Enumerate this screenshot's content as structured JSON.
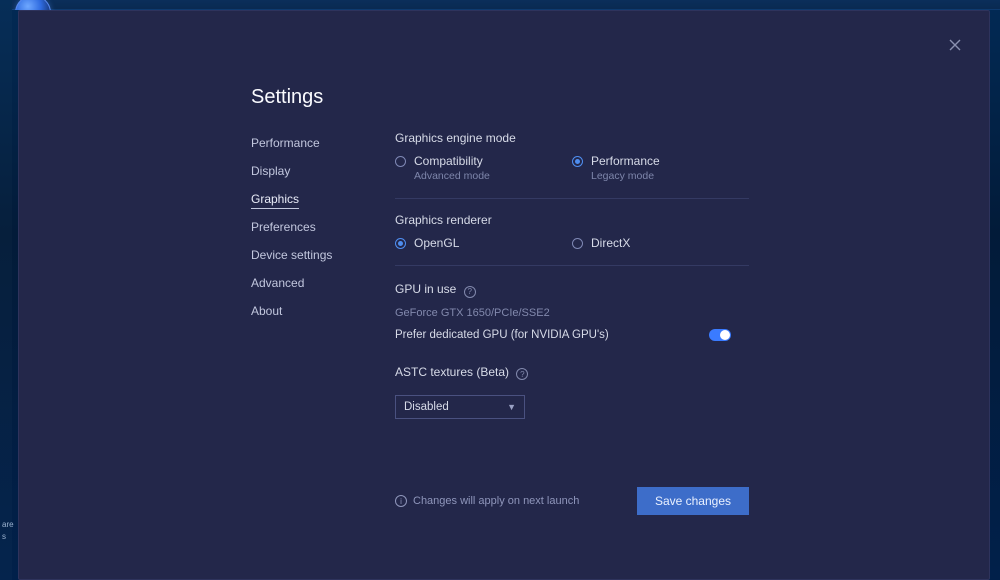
{
  "title": "Settings",
  "nav": {
    "items": [
      {
        "label": "Performance",
        "active": false
      },
      {
        "label": "Display",
        "active": false
      },
      {
        "label": "Graphics",
        "active": true
      },
      {
        "label": "Preferences",
        "active": false
      },
      {
        "label": "Device settings",
        "active": false
      },
      {
        "label": "Advanced",
        "active": false
      },
      {
        "label": "About",
        "active": false
      }
    ]
  },
  "sections": {
    "engine_mode": {
      "title": "Graphics engine mode",
      "options": [
        {
          "label": "Compatibility",
          "sub": "Advanced mode",
          "checked": false
        },
        {
          "label": "Performance",
          "sub": "Legacy mode",
          "checked": true
        }
      ]
    },
    "renderer": {
      "title": "Graphics renderer",
      "options": [
        {
          "label": "OpenGL",
          "checked": true
        },
        {
          "label": "DirectX",
          "checked": false
        }
      ]
    },
    "gpu": {
      "title": "GPU in use",
      "value": "GeForce GTX 1650/PCIe/SSE2",
      "prefer_label": "Prefer dedicated GPU (for NVIDIA GPU's)",
      "prefer_on": true
    },
    "astc": {
      "title": "ASTC textures (Beta)",
      "selected": "Disabled"
    }
  },
  "footer": {
    "note": "Changes will apply on next launch",
    "save": "Save changes"
  },
  "desktop": {
    "label1": "are",
    "label2": "s"
  }
}
